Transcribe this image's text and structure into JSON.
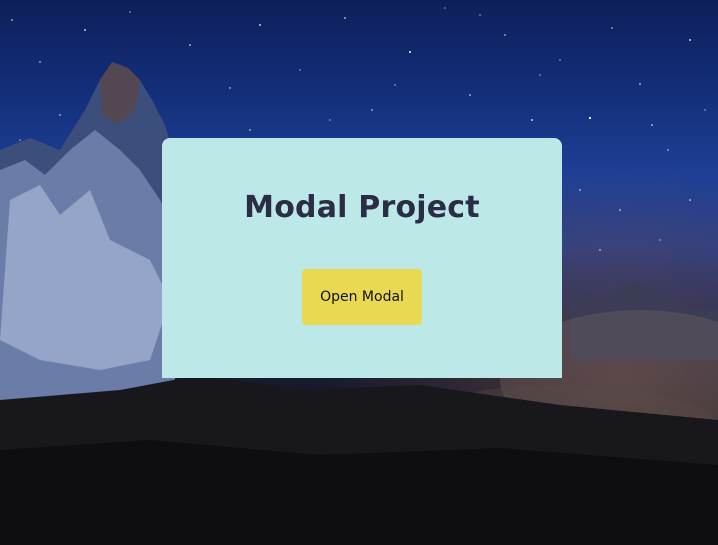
{
  "modal": {
    "title": "Modal Project",
    "open_button_label": "Open Modal"
  },
  "colors": {
    "card_background": "#bde8e8",
    "button_background": "#e8d852",
    "title_color": "#2a2d45"
  }
}
